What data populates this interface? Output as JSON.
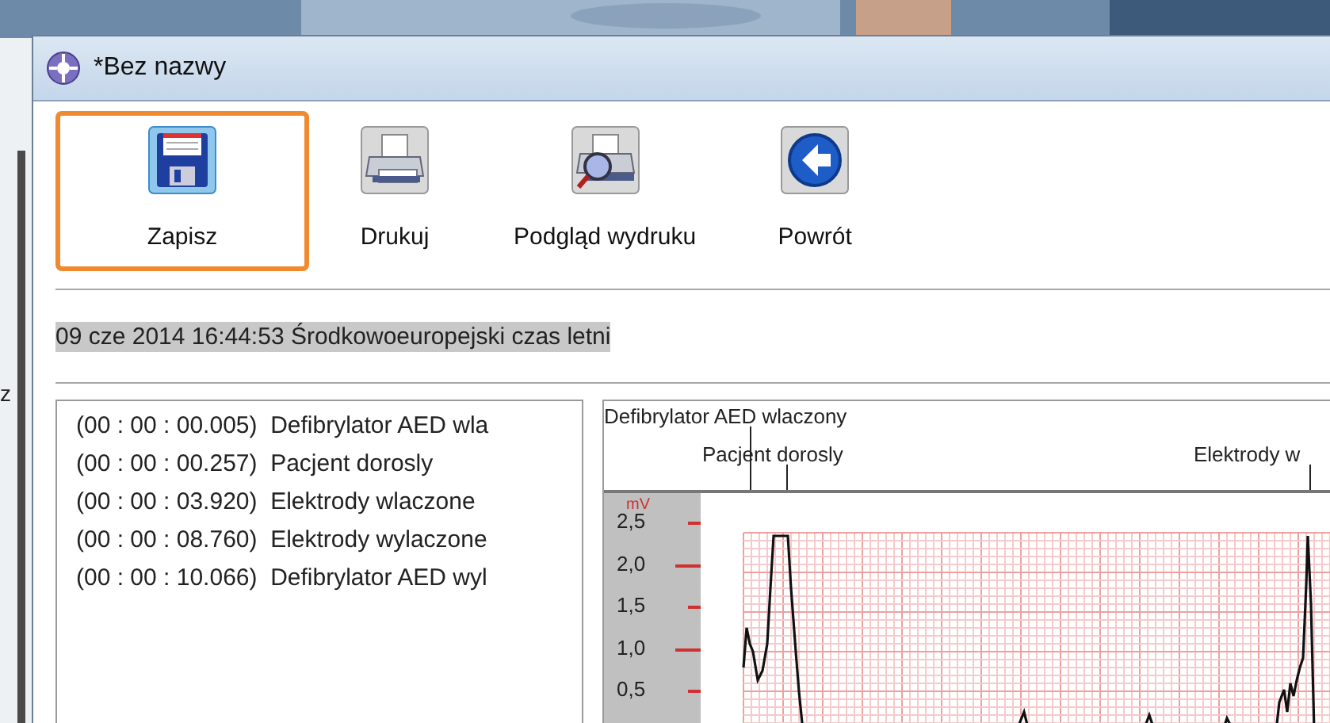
{
  "window": {
    "title": "*Bez nazwy"
  },
  "background_text": "z",
  "toolbar": [
    {
      "label": "Zapisz",
      "kind": "save",
      "selected": true
    },
    {
      "label": "Drukuj",
      "kind": "print",
      "selected": false
    },
    {
      "label": "Podgląd wydruku",
      "kind": "preview",
      "selected": false
    },
    {
      "label": "Powrót",
      "kind": "back",
      "selected": false
    }
  ],
  "recording_date": "09 cze 2014 16:44:53 Środkowoeuropejski czas letni",
  "events": [
    "(00 : 00 : 00.005)  Defibrylator AED wla",
    "(00 : 00 : 00.257)  Pacjent dorosly",
    "(00 : 00 : 03.920)  Elektrody wlaczone",
    "(00 : 00 : 08.760)  Elektrody wylaczone",
    "(00 : 00 : 10.066)  Defibrylator AED wyl"
  ],
  "chart": {
    "markers": [
      {
        "label": "Defibrylator AED wlaczony"
      },
      {
        "label": "Pacjent dorosly"
      },
      {
        "label": "Elektrody w"
      }
    ],
    "unit": "mV",
    "y_ticks": [
      "2,5",
      "2,0",
      "1,5",
      "1,0",
      "0,5"
    ]
  }
}
